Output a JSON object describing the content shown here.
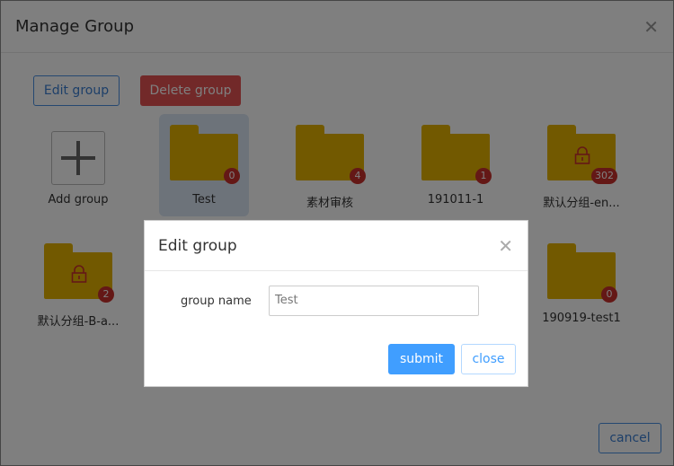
{
  "dialog": {
    "title": "Manage Group",
    "edit_group_label": "Edit group",
    "delete_group_label": "Delete group",
    "cancel_label": "cancel"
  },
  "add_tile": {
    "label": "Add group"
  },
  "groups": [
    {
      "name": "Test",
      "count": "0",
      "locked": false,
      "selected": true
    },
    {
      "name": "素材审核",
      "count": "4",
      "locked": false,
      "selected": false
    },
    {
      "name": "191011-1",
      "count": "1",
      "locked": false,
      "selected": false
    },
    {
      "name": "默认分组-en...",
      "count": "302",
      "locked": true,
      "selected": false
    },
    {
      "name": "默认分组-B-a...",
      "count": "2",
      "locked": true,
      "selected": false
    },
    {
      "name": "190919-test1",
      "count": "0",
      "locked": false,
      "selected": false
    }
  ],
  "edit_dialog": {
    "title": "Edit group",
    "field_label": "group name",
    "field_value": "Test",
    "submit_label": "submit",
    "close_label": "close"
  },
  "colors": {
    "folder": "#e5b300",
    "badge": "#c9302c",
    "primary": "#409eff",
    "danger": "#e55353"
  },
  "icons": {
    "outer_close": "close-icon",
    "inner_close": "close-icon",
    "add": "plus-icon",
    "lock": "lock-icon"
  }
}
